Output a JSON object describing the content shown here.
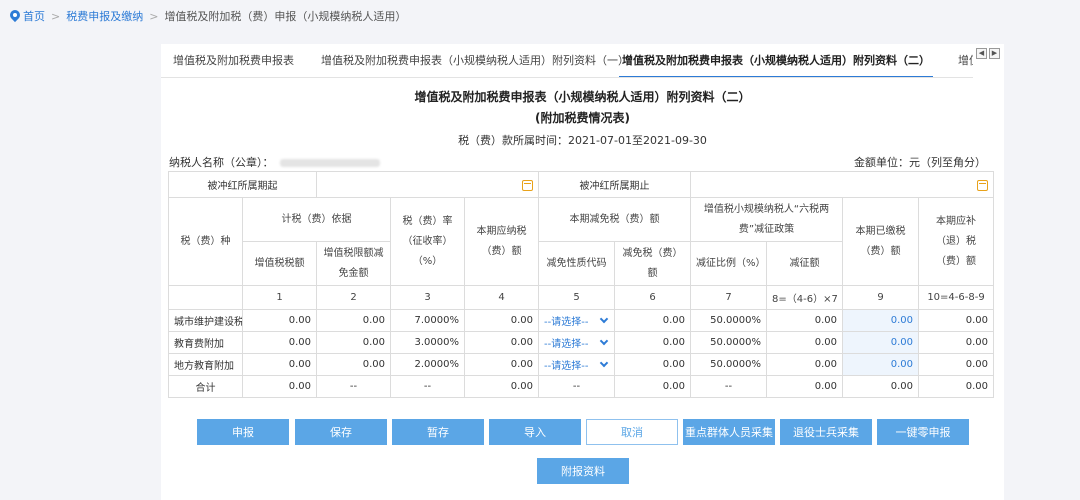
{
  "breadcrumb": {
    "home": "首页",
    "level1": "税费申报及缴纳",
    "current": "增值税及附加税（费）申报（小规模纳税人适用）"
  },
  "tabs": [
    {
      "label": "增值税及附加税费申报表",
      "active": false
    },
    {
      "label": "增值税及附加税费申报表（小规模纳税人适用）附列资料（一）",
      "active": false
    },
    {
      "label": "增值税及附加税费申报表（小规模纳税人适用）附列资料（二）",
      "active": true
    },
    {
      "label": "增值",
      "active": false
    }
  ],
  "form": {
    "title": "增值税及附加税费申报表（小规模纳税人适用）附列资料（二）",
    "subtitle": "(附加税费情况表)",
    "period": "税（费）款所属时间：2021-07-01至2021-09-30",
    "taxpayer_label": "纳税人名称（公章）：",
    "amount_unit": "金额单位：元（列至角分）"
  },
  "table": {
    "period_start_label": "被冲红所属期起",
    "period_end_label": "被冲红所属期止",
    "h_tax_type": "税（费）种",
    "h_basis": "计税（费）依据",
    "h_rate": "税（费）率（征收率）（%）",
    "h_payable": "本期应纳税（费）额",
    "h_reduction": "本期减免税（费）额",
    "h_policy": "增值税小规模纳税人“六税两费”减征政策",
    "h_paid": "本期已缴税（费）额",
    "h_refund": "本期应补（退）税（费）额",
    "h_vat_amount": "增值税税额",
    "h_vat_exempt": "增值税限额减免金额",
    "h_reduction_code": "减免性质代码",
    "h_reduction_amount": "减免税（费）额",
    "h_reduction_ratio": "减征比例（%）",
    "h_reduction_value": "减征额",
    "col_index": [
      "1",
      "2",
      "3",
      "4",
      "5",
      "6",
      "7",
      "8=（4-6）×7",
      "9",
      "10=4-6-8-9"
    ],
    "rows": [
      {
        "name": "城市维护建设税",
        "c1": "0.00",
        "c2": "0.00",
        "c3": "7.0000%",
        "c4": "0.00",
        "c5": "--请选择--",
        "c6": "0.00",
        "c7": "50.0000%",
        "c8": "0.00",
        "c9": "0.00",
        "c10": "0.00"
      },
      {
        "name": "教育费附加",
        "c1": "0.00",
        "c2": "0.00",
        "c3": "3.0000%",
        "c4": "0.00",
        "c5": "--请选择--",
        "c6": "0.00",
        "c7": "50.0000%",
        "c8": "0.00",
        "c9": "0.00",
        "c10": "0.00"
      },
      {
        "name": "地方教育附加",
        "c1": "0.00",
        "c2": "0.00",
        "c3": "2.0000%",
        "c4": "0.00",
        "c5": "--请选择--",
        "c6": "0.00",
        "c7": "50.0000%",
        "c8": "0.00",
        "c9": "0.00",
        "c10": "0.00"
      }
    ],
    "total": {
      "name": "合计",
      "c1": "0.00",
      "c2": "--",
      "c3": "--",
      "c4": "0.00",
      "c5": "--",
      "c6": "0.00",
      "c7": "--",
      "c8": "0.00",
      "c9": "0.00",
      "c10": "0.00"
    }
  },
  "buttons": {
    "declare": "申报",
    "save": "保存",
    "temp_save": "暂存",
    "import": "导入",
    "cancel": "取消",
    "key_group": "重点群体人员采集",
    "veteran": "退役士兵采集",
    "zero_declare": "一键零申报",
    "attachments": "附报资料"
  },
  "colors": {
    "accent": "#2d7bd6",
    "button": "#5ba6e6",
    "calendar_icon": "#e8a21b"
  }
}
